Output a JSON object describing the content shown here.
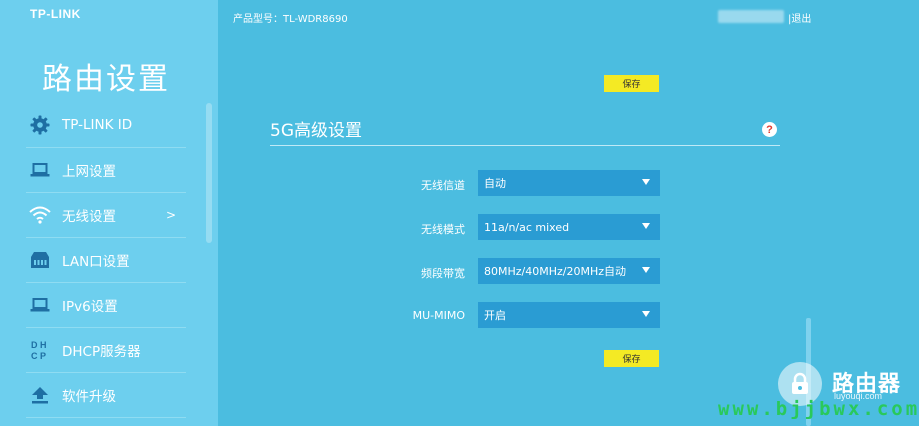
{
  "brand": {
    "logo": "TP-LINK",
    "title": "路由设置"
  },
  "sidebar": {
    "items": [
      {
        "label": "TP-LINK ID",
        "icon": "gear-icon"
      },
      {
        "label": "上网设置",
        "icon": "laptop-icon"
      },
      {
        "label": "无线设置",
        "icon": "wifi-icon",
        "arrow": ">",
        "active": true
      },
      {
        "label": "LAN口设置",
        "icon": "lan-icon"
      },
      {
        "label": "IPv6设置",
        "icon": "laptop-icon"
      },
      {
        "label": "DHCP服务器",
        "icon": "dhcp-icon"
      },
      {
        "label": "软件升级",
        "icon": "upload-icon"
      }
    ]
  },
  "header": {
    "model": "产品型号：TL-WDR8690",
    "logout": "|退出"
  },
  "main": {
    "save_label": "保存",
    "section_title": "5G高级设置",
    "help_label": "?",
    "fields": [
      {
        "label": "无线信道",
        "value": "自动"
      },
      {
        "label": "无线模式",
        "value": "11a/n/ac mixed"
      },
      {
        "label": "频段带宽",
        "value": "80MHz/40MHz/20MHz自动"
      },
      {
        "label": "MU-MIMO",
        "value": "开启"
      }
    ]
  },
  "watermark": {
    "name": "路由器",
    "domain": "luyouqi.com",
    "site": "www.bjjbwx.com"
  },
  "colors": {
    "sidebar_bg": "#6dcfee",
    "main_bg": "#4bbde0",
    "select_bg": "#2a9cd3",
    "save_bg": "#f4ea24",
    "watermark_green": "#29c95b"
  }
}
